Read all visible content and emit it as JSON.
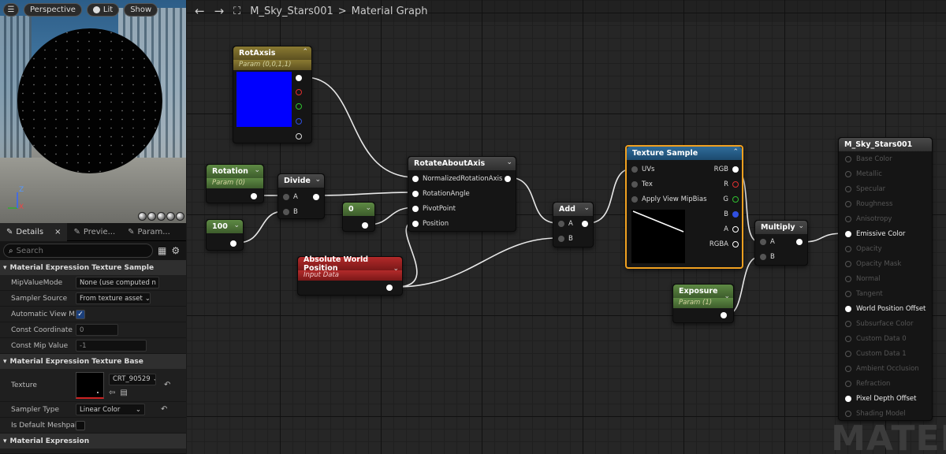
{
  "viewport": {
    "perspective": "Perspective",
    "lit": "Lit",
    "show": "Show",
    "axis_z": "Z",
    "axis_x": "X"
  },
  "details_tabs": [
    {
      "label": "Details",
      "close": "×"
    },
    {
      "label": "Previe..."
    },
    {
      "label": "Param..."
    }
  ],
  "search": {
    "placeholder": "Search"
  },
  "sections": {
    "texture_sample": "Material Expression Texture Sample",
    "texture_base": "Material Expression Texture Base",
    "expression": "Material Expression"
  },
  "properties": {
    "mip_value_mode": {
      "label": "MipValueMode",
      "value": "None (use computed n"
    },
    "sampler_source": {
      "label": "Sampler Source",
      "value": "From texture asset"
    },
    "automatic_view_mip": {
      "label": "Automatic View M...",
      "checked": true
    },
    "const_coordinate": {
      "label": "Const Coordinate",
      "value": "0"
    },
    "const_mip_value": {
      "label": "Const Mip Value",
      "value": "-1"
    },
    "texture": {
      "label": "Texture",
      "value": "CRT_90529"
    },
    "sampler_type": {
      "label": "Sampler Type",
      "value": "Linear Color"
    },
    "is_default_mesh": {
      "label": "Is Default Meshpai...",
      "checked": false
    }
  },
  "graph": {
    "breadcrumb_asset": "M_Sky_Stars001",
    "breadcrumb_sep": ">",
    "breadcrumb_graph": "Material Graph",
    "watermark": "MATEI"
  },
  "nodes": {
    "rotaxis": {
      "title": "RotAxsis",
      "subtitle": "Param (0,0,1,1)",
      "color": "#0000ff"
    },
    "rotation": {
      "title": "Rotation",
      "subtitle": "Param (0)"
    },
    "divide": {
      "title": "Divide",
      "pin_a": "A",
      "pin_b": "B"
    },
    "c100": {
      "title": "100"
    },
    "c0": {
      "title": "0"
    },
    "rotate": {
      "title": "RotateAboutAxis",
      "pins": [
        "NormalizedRotationAxis",
        "RotationAngle",
        "PivotPoint",
        "Position"
      ]
    },
    "awp": {
      "title": "Absolute World Position",
      "subtitle": "Input Data"
    },
    "add": {
      "title": "Add",
      "pin_a": "A",
      "pin_b": "B"
    },
    "texsample": {
      "title": "Texture Sample",
      "inputs": [
        "UVs",
        "Tex",
        "Apply View MipBias"
      ],
      "outputs": [
        "RGB",
        "R",
        "G",
        "B",
        "A",
        "RGBA"
      ]
    },
    "exposure": {
      "title": "Exposure",
      "subtitle": "Param (1)"
    },
    "multiply": {
      "title": "Multiply",
      "pin_a": "A",
      "pin_b": "B"
    },
    "output": {
      "title": "M_Sky_Stars001",
      "pins": [
        {
          "label": "Base Color",
          "active": false
        },
        {
          "label": "Metallic",
          "active": false
        },
        {
          "label": "Specular",
          "active": false
        },
        {
          "label": "Roughness",
          "active": false
        },
        {
          "label": "Anisotropy",
          "active": false
        },
        {
          "label": "Emissive Color",
          "active": true
        },
        {
          "label": "Opacity",
          "active": false
        },
        {
          "label": "Opacity Mask",
          "active": false
        },
        {
          "label": "Normal",
          "active": false
        },
        {
          "label": "Tangent",
          "active": false
        },
        {
          "label": "World Position Offset",
          "active": true
        },
        {
          "label": "Subsurface Color",
          "active": false
        },
        {
          "label": "Custom Data 0",
          "active": false
        },
        {
          "label": "Custom Data 1",
          "active": false
        },
        {
          "label": "Ambient Occlusion",
          "active": false
        },
        {
          "label": "Refraction",
          "active": false
        },
        {
          "label": "Pixel Depth Offset",
          "active": true
        },
        {
          "label": "Shading Model",
          "active": false
        }
      ]
    }
  },
  "colors": {
    "accent_orange": "#f0a020",
    "pin_red": "#e03030",
    "pin_green": "#30c030",
    "pin_blue": "#3050e0"
  }
}
